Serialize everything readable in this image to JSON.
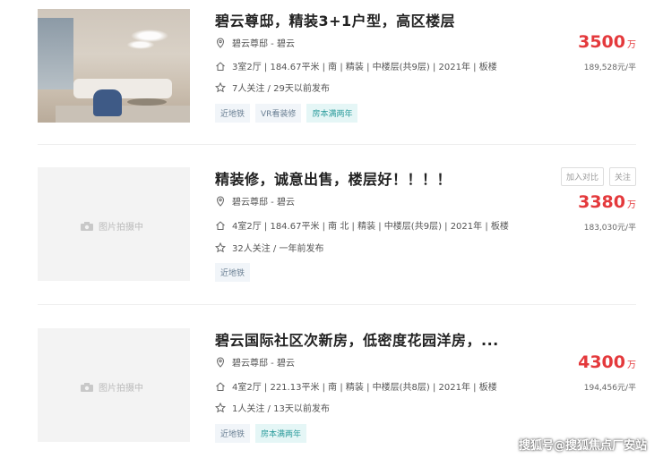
{
  "listings": [
    {
      "title": "碧云尊邸，精装3+1户型，高区楼层",
      "location": "碧云尊邸 - 碧云",
      "details": "3室2厅 | 184.67平米 | 南 | 精装 | 中楼层(共9层) | 2021年 | 板楼",
      "followers": "7人关注 / 29天以前发布",
      "tags": [
        "近地铁",
        "VR看装修",
        "房本满两年"
      ],
      "price": "3500",
      "price_unit": "万",
      "unit_price": "189,528元/平",
      "has_photo": true
    },
    {
      "title": "精装修，诚意出售，楼层好！！！！",
      "location": "碧云尊邸 - 碧云",
      "details": "4室2厅 | 184.67平米 | 南 北 | 精装 | 中楼层(共9层) | 2021年 | 板楼",
      "followers": "32人关注 / 一年前发布",
      "tags": [
        "近地铁"
      ],
      "price": "3380",
      "price_unit": "万",
      "unit_price": "183,030元/平",
      "placeholder": "图片拍摄中",
      "actions": [
        "加入对比",
        "关注"
      ]
    },
    {
      "title": "碧云国际社区次新房，低密度花园洋房，...",
      "location": "碧云尊邸 - 碧云",
      "details": "4室2厅 | 221.13平米 | 南 | 精装 | 中楼层(共8层) | 2021年 | 板楼",
      "followers": "1人关注 / 13天以前发布",
      "tags": [
        "近地铁",
        "房本满两年"
      ],
      "price": "4300",
      "price_unit": "万",
      "unit_price": "194,456元/平",
      "placeholder": "图片拍摄中"
    }
  ],
  "watermark": "搜狐号@搜狐焦点厂安站",
  "colors": {
    "price": "#e4393c",
    "tag_highlight": "#2c9c9c"
  },
  "icons": [
    "location-pin-icon",
    "house-icon",
    "star-icon",
    "camera-icon"
  ]
}
